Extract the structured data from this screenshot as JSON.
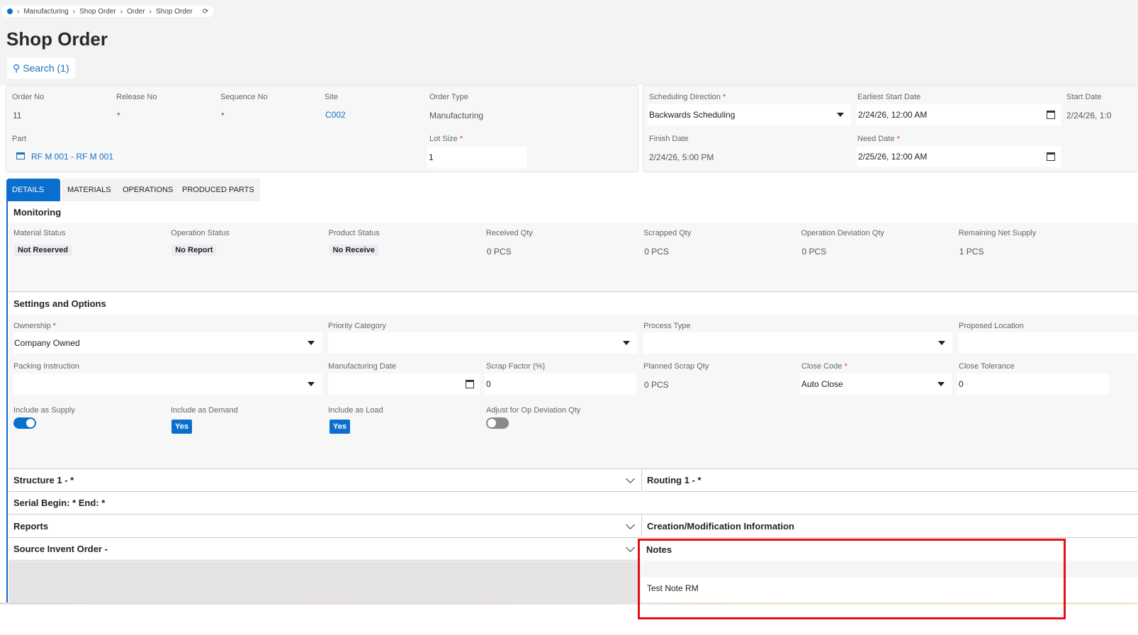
{
  "breadcrumb": [
    "Manufacturing",
    "Shop Order",
    "Order",
    "Shop Order"
  ],
  "page_title": "Shop Order",
  "search_label": "Search (1)",
  "header": {
    "order_no": {
      "label": "Order No",
      "value": "11"
    },
    "release_no": {
      "label": "Release No",
      "value": "*"
    },
    "sequence_no": {
      "label": "Sequence No",
      "value": "*"
    },
    "site": {
      "label": "Site",
      "value": "C002"
    },
    "order_type": {
      "label": "Order Type",
      "value": "Manufacturing"
    },
    "part": {
      "label": "Part",
      "value": "RF M 001 - RF M 001"
    },
    "lot_size": {
      "label": "Lot Size",
      "value": "1"
    },
    "scheduling_direction": {
      "label": "Scheduling Direction",
      "value": "Backwards Scheduling"
    },
    "earliest_start_date": {
      "label": "Earliest Start Date",
      "value": "2/24/26, 12:00 AM"
    },
    "start_date": {
      "label": "Start Date",
      "value": "2/24/26, 1:0"
    },
    "finish_date": {
      "label": "Finish Date",
      "value": "2/24/26, 5:00 PM"
    },
    "need_date": {
      "label": "Need Date",
      "value": "2/25/26, 12:00 AM"
    }
  },
  "tabs": [
    "DETAILS",
    "MATERIALS",
    "OPERATIONS",
    "PRODUCED PARTS"
  ],
  "monitoring": {
    "title": "Monitoring",
    "fields": [
      {
        "label": "Material Status",
        "value": "Not Reserved",
        "badge": true
      },
      {
        "label": "Operation Status",
        "value": "No Report",
        "badge": true
      },
      {
        "label": "Product Status",
        "value": "No Receive",
        "badge": true
      },
      {
        "label": "Received Qty",
        "value": "0 PCS"
      },
      {
        "label": "Scrapped Qty",
        "value": "0 PCS"
      },
      {
        "label": "Operation Deviation Qty",
        "value": "0 PCS"
      },
      {
        "label": "Remaining Net Supply",
        "value": "1 PCS"
      }
    ]
  },
  "settings": {
    "title": "Settings and Options",
    "ownership": {
      "label": "Ownership",
      "value": "Company Owned"
    },
    "priority_category": {
      "label": "Priority Category",
      "value": ""
    },
    "process_type": {
      "label": "Process Type",
      "value": ""
    },
    "proposed_location": {
      "label": "Proposed Location",
      "value": ""
    },
    "packing_instruction": {
      "label": "Packing Instruction",
      "value": ""
    },
    "manufacturing_date": {
      "label": "Manufacturing Date",
      "value": ""
    },
    "scrap_factor": {
      "label": "Scrap Factor (%)",
      "value": "0"
    },
    "planned_scrap_qty": {
      "label": "Planned Scrap Qty",
      "value": "0 PCS"
    },
    "close_code": {
      "label": "Close Code",
      "value": "Auto Close"
    },
    "close_tolerance": {
      "label": "Close Tolerance",
      "value": "0"
    },
    "include_as_supply": {
      "label": "Include as Supply",
      "on": true
    },
    "include_as_demand": {
      "label": "Include as Demand",
      "value": "Yes"
    },
    "include_as_load": {
      "label": "Include as Load",
      "value": "Yes"
    },
    "adjust_op_deviation": {
      "label": "Adjust for Op Deviation Qty",
      "on": false
    }
  },
  "sections": {
    "structure": "Structure 1 - *",
    "routing": "Routing 1 - *",
    "serial": "Serial Begin: * End: *",
    "reports": "Reports",
    "creation": "Creation/Modification Information",
    "source": "Source Invent Order -",
    "notes": "Notes",
    "notes_text": "Test Note RM"
  },
  "colors": {
    "accent": "#0b6fcf",
    "highlight": "#e3101a"
  }
}
